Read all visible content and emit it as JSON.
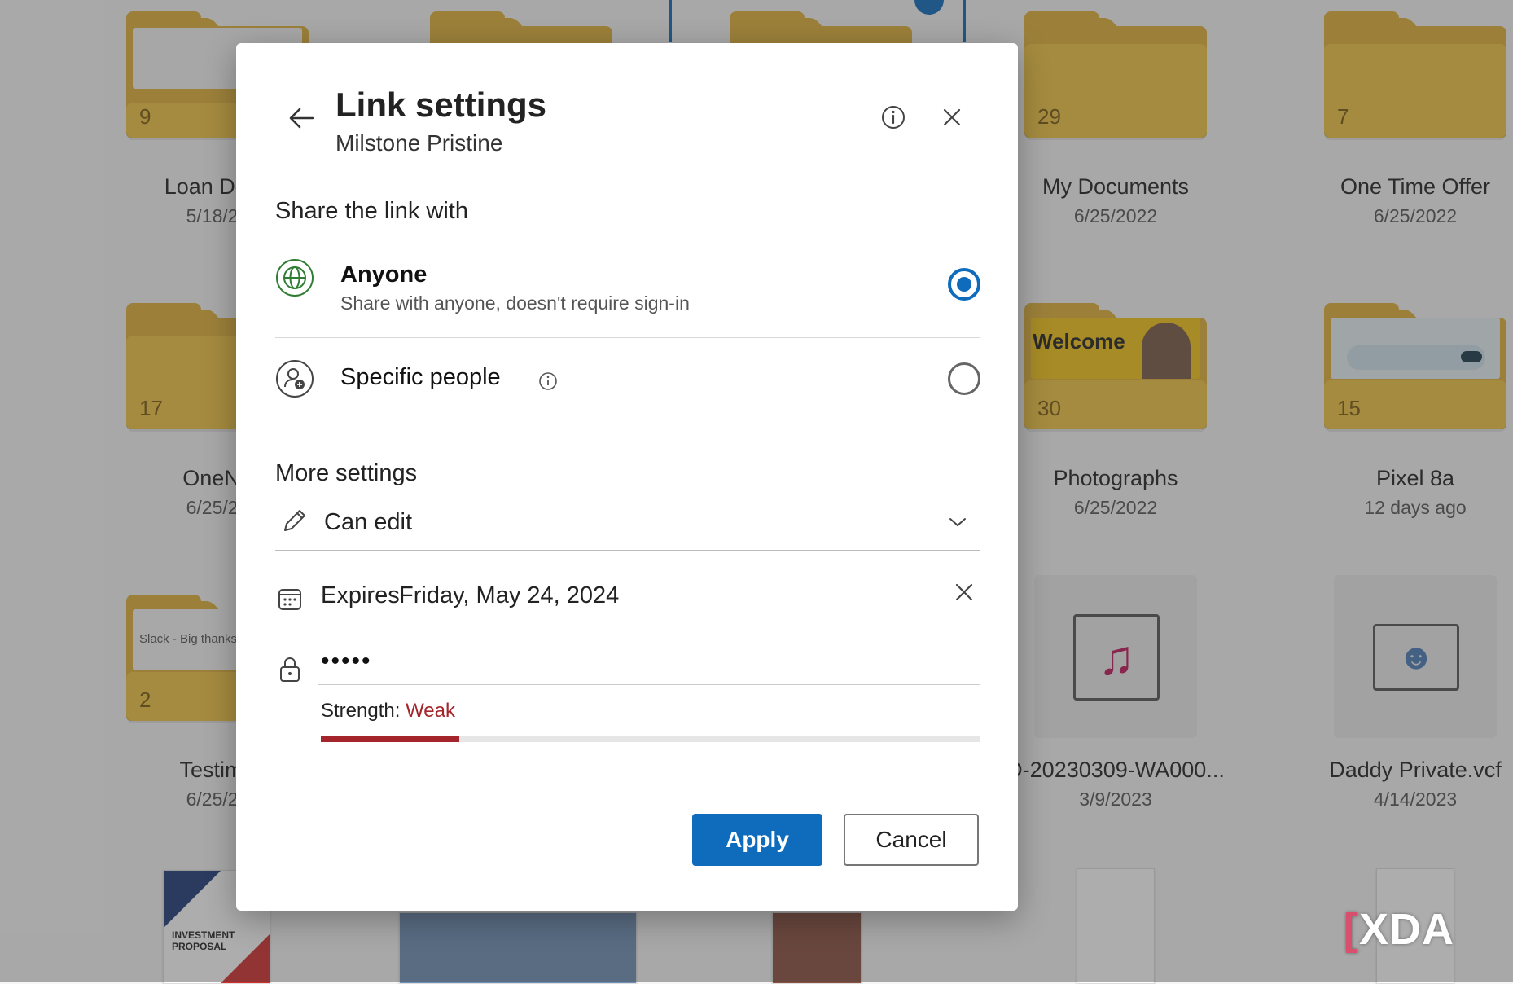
{
  "background": {
    "tiles": [
      {
        "id": "loan",
        "name": "Loan Docu",
        "date": "5/18/20",
        "count": "9"
      },
      {
        "id": "mydocs",
        "name": "My Documents",
        "date": "6/25/2022",
        "count": "29"
      },
      {
        "id": "onetime",
        "name": "One Time Offer",
        "date": "6/25/2022",
        "count": "7"
      },
      {
        "id": "onenote",
        "name": "OneNo",
        "date": "6/25/20",
        "count": "17"
      },
      {
        "id": "photos",
        "name": "Photographs",
        "date": "6/25/2022",
        "count": "30",
        "thumb_text": "Welcome"
      },
      {
        "id": "pixel",
        "name": "Pixel 8a",
        "date": "12 days ago",
        "count": "15"
      },
      {
        "id": "testimo",
        "name": "Testimo",
        "date": "6/25/20",
        "count": "2",
        "thumb_text": "Slack - Big thanks"
      },
      {
        "id": "audio",
        "name": "D-20230309-WA000...",
        "date": "3/9/2023"
      },
      {
        "id": "vcf",
        "name": "Daddy Private.vcf",
        "date": "4/14/2023"
      }
    ],
    "doc_thumb_text": "INVESTMENT PROPOSAL",
    "watermark": "XDA"
  },
  "dialog": {
    "title": "Link settings",
    "subtitle": "Milstone Pristine",
    "share_label": "Share the link with",
    "options": [
      {
        "title": "Anyone",
        "description": "Share with anyone, doesn't require sign-in",
        "selected": true
      },
      {
        "title": "Specific people",
        "selected": false
      }
    ],
    "more_settings_label": "More settings",
    "permission": "Can edit",
    "expires_label": "Expires",
    "expires_value": "Friday, May 24, 2024",
    "password_mask": "•••••",
    "strength_label": "Strength:",
    "strength_value": "Weak",
    "strength_fraction": 0.21,
    "apply_label": "Apply",
    "cancel_label": "Cancel"
  },
  "colors": {
    "accent": "#0f6cbd",
    "weak": "#a4262c",
    "folder": "#f2c442"
  }
}
